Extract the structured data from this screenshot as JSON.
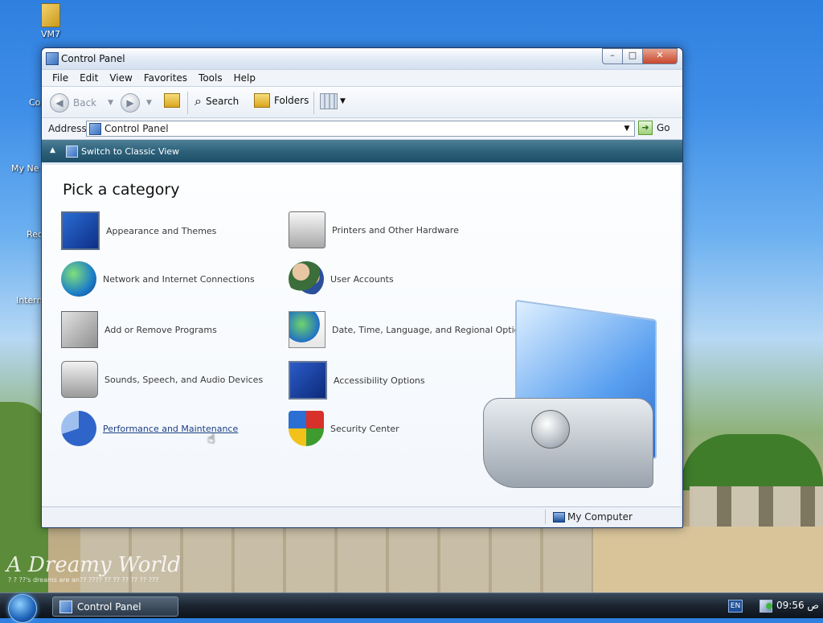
{
  "desktop": {
    "icons": [
      {
        "label": "VM7"
      }
    ],
    "partial_labels": [
      "Co",
      "My Ne",
      "Rec",
      "Intern"
    ],
    "wallpaper_text": "A Dreamy World",
    "wallpaper_subtext": "? ? ??'s dreams are an?? ???? ?? ?? ?? ?? ?? ???"
  },
  "window": {
    "title": "Control Panel",
    "buttons": {
      "minimize": "–",
      "maximize": "□",
      "close": "✕"
    },
    "menu": [
      "File",
      "Edit",
      "View",
      "Favorites",
      "Tools",
      "Help"
    ],
    "toolbar": {
      "back": "Back",
      "search": "Search",
      "folders": "Folders"
    },
    "address": {
      "label": "Address",
      "value": "Control Panel",
      "go": "Go"
    },
    "classic_view_link": "Switch to Classic View",
    "heading": "Pick a category",
    "categories": [
      {
        "label": "Appearance and Themes",
        "icon": "appearance-themes-icon"
      },
      {
        "label": "Network and Internet Connections",
        "icon": "network-icon"
      },
      {
        "label": "Add or Remove Programs",
        "icon": "add-remove-programs-icon"
      },
      {
        "label": "Sounds, Speech, and Audio Devices",
        "icon": "sound-icon"
      },
      {
        "label": "Performance and Maintenance",
        "icon": "performance-icon"
      },
      {
        "label": "Printers and Other Hardware",
        "icon": "printer-icon"
      },
      {
        "label": "User Accounts",
        "icon": "user-accounts-icon"
      },
      {
        "label": "Date, Time, Language, and Regional Options",
        "icon": "date-time-icon"
      },
      {
        "label": "Accessibility Options",
        "icon": "accessibility-icon"
      },
      {
        "label": "Security Center",
        "icon": "security-center-icon"
      }
    ],
    "status": {
      "location": "My Computer"
    }
  },
  "taskbar": {
    "task": "Control Panel",
    "lang": "EN",
    "clock": "09:56 ص"
  }
}
